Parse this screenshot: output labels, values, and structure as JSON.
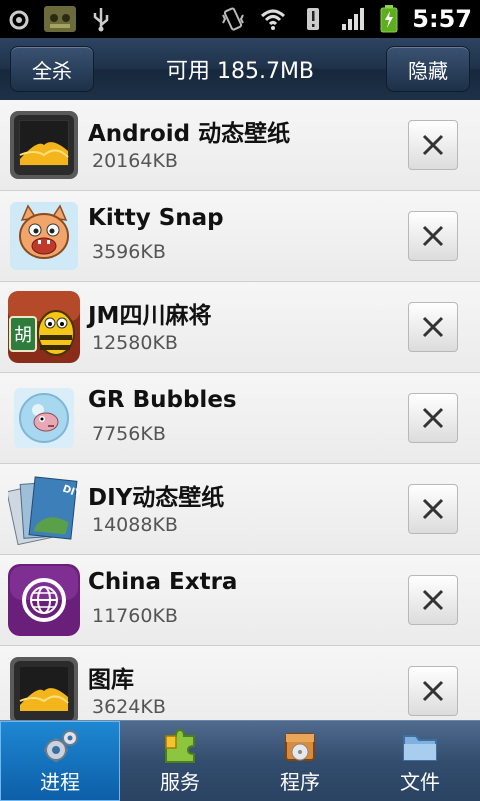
{
  "status_bar": {
    "time": "5:57",
    "icons": [
      "usb-debug-icon",
      "android-notification-icon",
      "usb-icon",
      "vibrate-icon",
      "wifi-icon",
      "alert-icon",
      "signal-icon",
      "battery-charging-icon"
    ]
  },
  "header": {
    "left_button": "全杀",
    "title": "可用 185.7MB",
    "right_button": "隐藏"
  },
  "apps": [
    {
      "name": "Android 动态壁纸",
      "size": "20164KB",
      "icon": "gallery-picture-icon"
    },
    {
      "name": "Kitty Snap",
      "size": "3596KB",
      "icon": "kitty-cat-icon"
    },
    {
      "name": "JM四川麻将",
      "size": "12580KB",
      "icon": "mahjong-bee-icon"
    },
    {
      "name": "GR Bubbles",
      "size": "7756KB",
      "icon": "bubble-fish-icon"
    },
    {
      "name": "DIY动态壁纸",
      "size": "14088KB",
      "icon": "photo-stack-icon"
    },
    {
      "name": "China Extra",
      "size": "11760KB",
      "icon": "globe-icon"
    },
    {
      "name": "图库",
      "size": "3624KB",
      "icon": "gallery-picture-icon"
    }
  ],
  "tabs": [
    {
      "label": "进程",
      "icon": "gears-icon",
      "active": true
    },
    {
      "label": "服务",
      "icon": "puzzle-icon",
      "active": false
    },
    {
      "label": "程序",
      "icon": "package-icon",
      "active": false
    },
    {
      "label": "文件",
      "icon": "folder-icon",
      "active": false
    }
  ],
  "colors": {
    "header_bg": "#1f324b",
    "tab_active": "#1e88d2",
    "list_bg": "#f1f1f1"
  }
}
